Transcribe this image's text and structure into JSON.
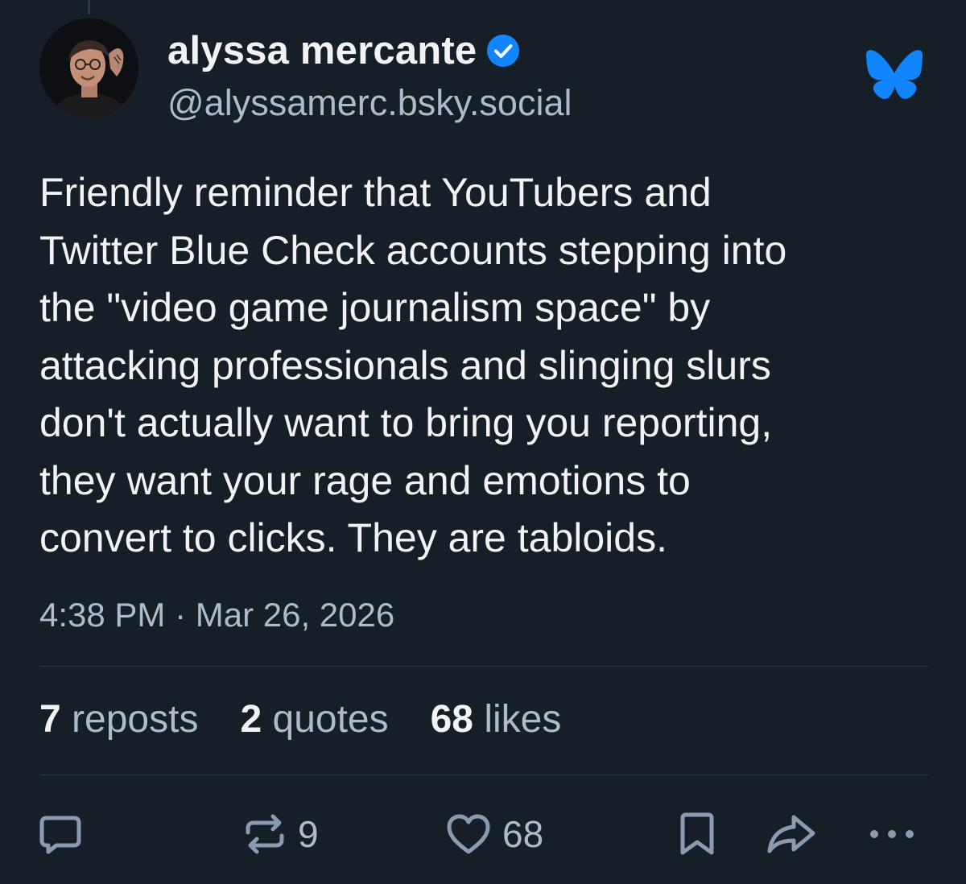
{
  "author": {
    "display_name": "alyssa mercante",
    "handle": "@alyssamerc.bsky.social",
    "verified": true
  },
  "post": {
    "text": "Friendly reminder that YouTubers and\nTwitter Blue Check accounts stepping into\nthe \"video game journalism space\" by\nattacking professionals and slinging slurs\ndon't actually want to bring you reporting,\nthey want your rage and emotions to\nconvert to clicks. They are tabloids.",
    "timestamp": "4:38 PM · Mar 26, 2026"
  },
  "stats": {
    "reposts_count": "7",
    "reposts_label": " reposts",
    "quotes_count": "2",
    "quotes_label": " quotes",
    "likes_count": "68",
    "likes_label": " likes"
  },
  "actions": {
    "reply_icon": "speech-bubble-icon",
    "repost_icon": "repost-arrows-icon",
    "repost_count": "9",
    "like_icon": "heart-icon",
    "like_count": "68",
    "bookmark_icon": "bookmark-icon",
    "share_icon": "share-arrow-icon",
    "more_icon": "ellipsis-icon"
  },
  "colors": {
    "background": "#161e27",
    "text_primary": "#f1f3f5",
    "text_secondary": "#aebbc9",
    "icon": "#8a9bb0",
    "brand_blue": "#1185fe",
    "divider": "#2e3844"
  }
}
